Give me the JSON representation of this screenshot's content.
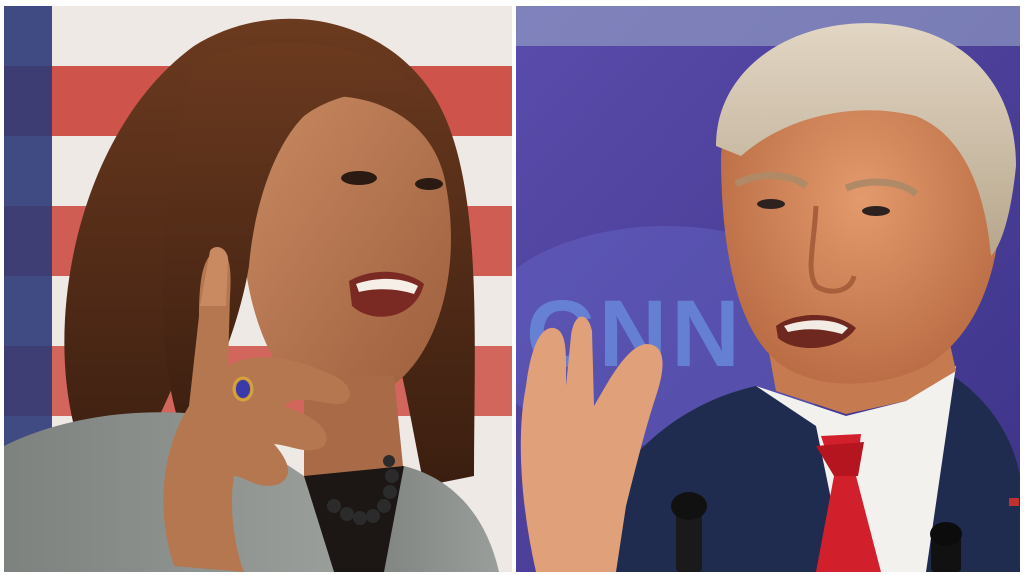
{
  "photos": {
    "left": {
      "subject": "woman-speaking-raised-finger"
    },
    "right": {
      "subject": "man-speaking-raised-hand",
      "backdrop_text": "CNN"
    }
  },
  "colors": {
    "flag_red": "#c8392f",
    "flag_navy": "#2d3a78",
    "backdrop_purple": "#4a3f9c",
    "backdrop_logo": "#6a8fe0",
    "jacket_gray": "#8a8f8c",
    "suit_navy": "#1f2c4f",
    "tie_red": "#d21f2c"
  }
}
